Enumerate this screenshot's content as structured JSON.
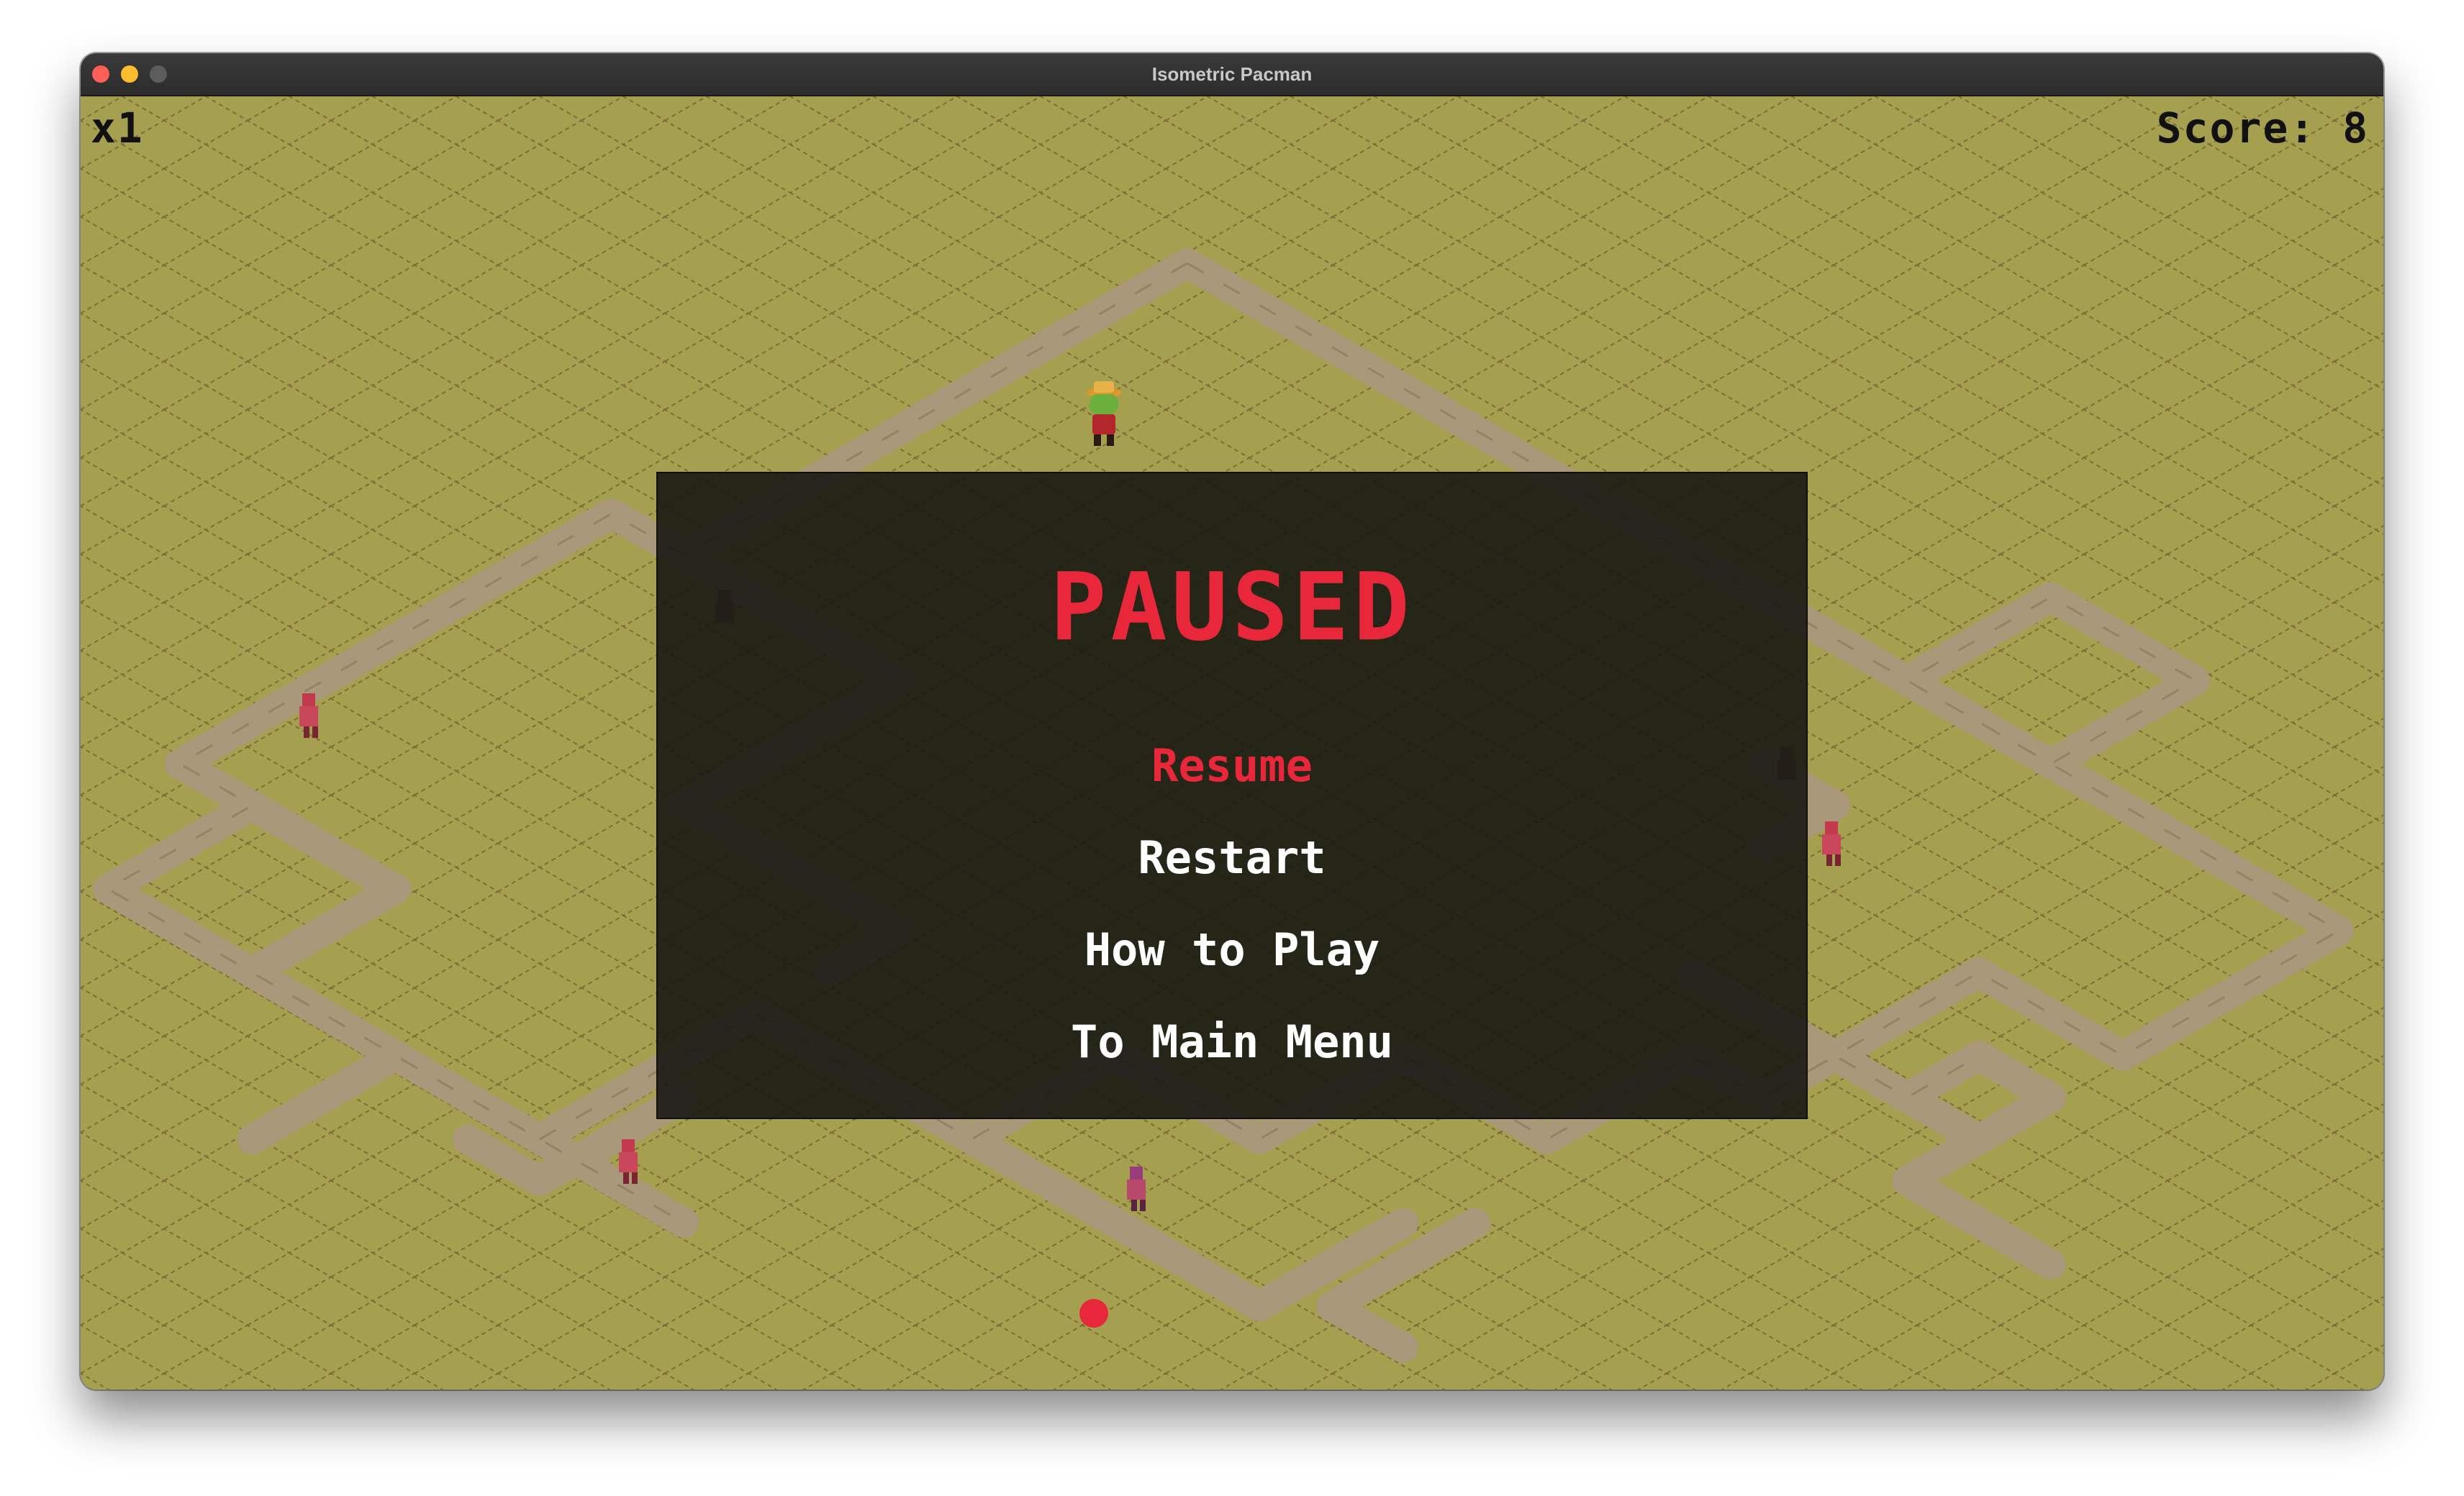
{
  "window": {
    "title": "Isometric Pacman"
  },
  "hud": {
    "multiplier": "x1",
    "score": "Score: 8"
  },
  "pause_menu": {
    "title": "PAUSED",
    "items": [
      {
        "label": "Resume",
        "selected": true
      },
      {
        "label": "Restart",
        "selected": false
      },
      {
        "label": "How to Play",
        "selected": false
      },
      {
        "label": "To Main Menu",
        "selected": false
      }
    ]
  },
  "colors": {
    "grass": "#a5a04f",
    "path": "#a9987a",
    "accent_red": "#e8283a",
    "menu_text": "#ffffff",
    "overlay": "#16160f"
  },
  "entities": {
    "player": "player-character",
    "enemies": [
      "enemy-robot",
      "enemy-robot",
      "enemy-robot",
      "enemy-robot",
      "enemy-robot",
      "enemy-robot"
    ],
    "pellet": "red-pellet"
  }
}
